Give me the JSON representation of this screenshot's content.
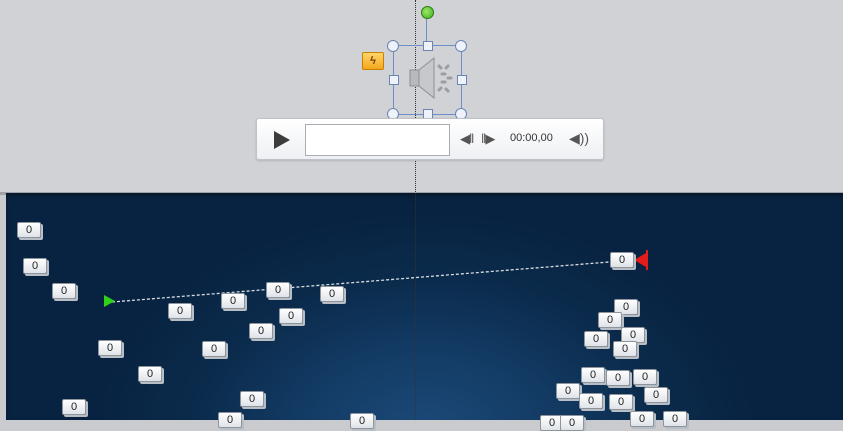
{
  "player": {
    "time": "00:00,00",
    "skip_back": "◀‖",
    "skip_forward": "‖▶",
    "volume": "◀))"
  },
  "trigger": {
    "glyph": "ϟ"
  },
  "markers": [
    "0",
    "0",
    "0",
    "0",
    "0",
    "0",
    "0",
    "0",
    "0",
    "0",
    "0",
    "0",
    "0",
    "0",
    "0",
    "0",
    "0",
    "0",
    "0",
    "0",
    "0",
    "0",
    "0",
    "0",
    "0",
    "0",
    "0",
    "0",
    "0",
    "0",
    "0",
    "0",
    "0"
  ],
  "colors": {
    "slide_background": "#0b2b4c",
    "path_start": "#2fd11a",
    "path_end": "#e21b1b",
    "selection": "#6a8fc9"
  },
  "icons": [
    "speaker-icon",
    "play-icon",
    "skip-back-icon",
    "skip-forward-icon",
    "volume-icon",
    "trigger-icon",
    "path-start-icon",
    "path-end-icon"
  ]
}
